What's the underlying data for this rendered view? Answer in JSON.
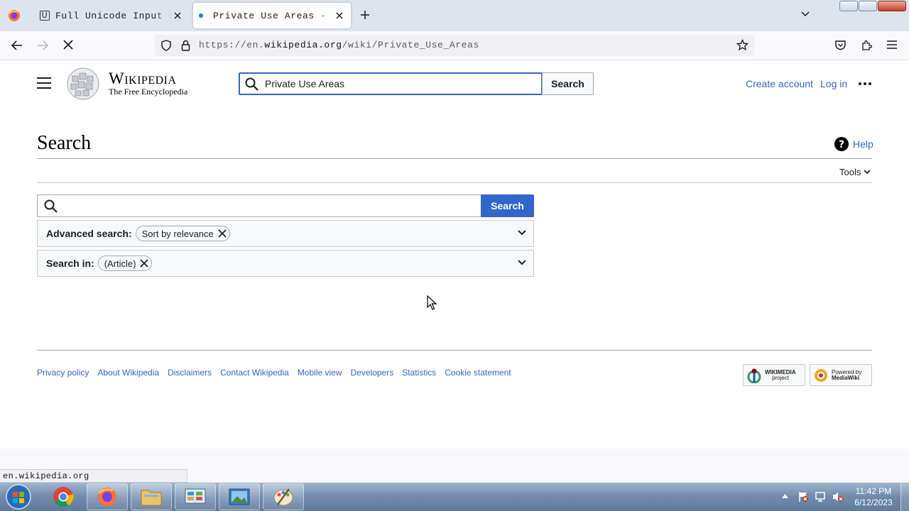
{
  "browser": {
    "tabs": [
      {
        "label": "Full Unicode Input utility",
        "active": false
      },
      {
        "label": "Private Use Areas - Wikipedia",
        "active": true
      }
    ],
    "url_prefix": "https://en.",
    "url_domain": "wikipedia.org",
    "url_path": "/wiki/Private_Use_Areas",
    "status_url": "en.wikipedia.org"
  },
  "wiki": {
    "wordmark": "Wikipedia",
    "tagline": "The Free Encyclopedia",
    "header_search_value": "Private Use Areas",
    "header_search_button": "Search",
    "create_account": "Create account",
    "log_in": "Log in",
    "page_title": "Search",
    "help": "Help",
    "tools": "Tools",
    "search_value": "",
    "search_button": "Search",
    "advanced_label": "Advanced search:",
    "advanced_chip": "Sort by relevance",
    "search_in_label": "Search in:",
    "search_in_chip": "(Article)",
    "footer_links": [
      "Privacy policy",
      "About Wikipedia",
      "Disclaimers",
      "Contact Wikipedia",
      "Mobile view",
      "Developers",
      "Statistics",
      "Cookie statement"
    ],
    "badge_wikimedia": [
      "WIKIMEDIA",
      "project"
    ],
    "badge_mediawiki": [
      "Powered by",
      "MediaWiki"
    ]
  },
  "taskbar": {
    "time": "11:42 PM",
    "date": "6/12/2023"
  },
  "colors": {
    "link": "#3366cc",
    "search_button": "#3366cc"
  }
}
